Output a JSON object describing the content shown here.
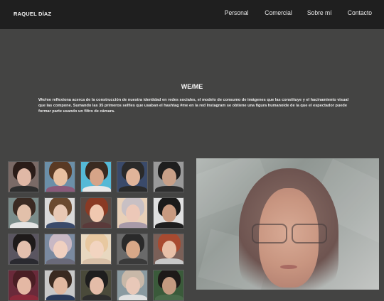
{
  "header": {
    "brand": "RAQUEL DÍAZ",
    "nav": [
      "Personal",
      "Comercial",
      "Sobre mí",
      "Contacto"
    ]
  },
  "section": {
    "title": "WE/ME",
    "description": "We/me reflexiona acerca de la construcción de nuestra identidad en redes sociales, el modelo de consumo de imágenes que las constituye y el hacinamiento visual que las compone. Sumando las 35 primeros selfies que usaban el hashtag #me en la red Instagram se obtiene una figura humanoide de la que el espectador puede formar parte usando un filtro de cámara."
  },
  "gallery": {
    "thumbnails": [
      {
        "bg": "#7a6a66",
        "hair": "#2a1c18",
        "skin": "#e0b8a6",
        "cloth": "#2e2e2e"
      },
      {
        "bg": "#6b8fa8",
        "hair": "#5a3a24",
        "skin": "#e8c0a0",
        "cloth": "#8a5a7a"
      },
      {
        "bg": "#55b9d6",
        "hair": "#3a2a20",
        "skin": "#d6a488",
        "cloth": "#e8e8e8"
      },
      {
        "bg": "#3a4a6a",
        "hair": "#2a2a2a",
        "skin": "#e0b49a",
        "cloth": "#2a2a2a"
      },
      {
        "bg": "#9a9a9a",
        "hair": "#1e1e1e",
        "skin": "#c8a088",
        "cloth": "#2e2e2e"
      },
      {
        "bg": "#7a8c8a",
        "hair": "#3a2a22",
        "skin": "#e2c0aa",
        "cloth": "#e4e4e4"
      },
      {
        "bg": "#d9d9d9",
        "hair": "#6b4a30",
        "skin": "#e8c8b4",
        "cloth": "#3a4a6a"
      },
      {
        "bg": "#5a4a44",
        "hair": "#8a3a24",
        "skin": "#f0c8b0",
        "cloth": "#5a3a3a"
      },
      {
        "bg": "#e8d0b8",
        "hair": "#c8c0c4",
        "skin": "#ecc8b8",
        "cloth": "#a89aa8"
      },
      {
        "bg": "#e0e0e0",
        "hair": "#1a1a1a",
        "skin": "#c89a80",
        "cloth": "#1e1e1e"
      },
      {
        "bg": "#5a5560",
        "hair": "#1e1a1a",
        "skin": "#e4c0ae",
        "cloth": "#2a2a30"
      },
      {
        "bg": "#7a8aa0",
        "hair": "#c8b8c4",
        "skin": "#f0d0c0",
        "cloth": "#6a6a7a"
      },
      {
        "bg": "#e8d8c0",
        "hair": "#e8c8a0",
        "skin": "#f2d4c0",
        "cloth": "#d8c0a8"
      },
      {
        "bg": "#6a6a6a",
        "hair": "#2a2a2a",
        "skin": "#d8a888",
        "cloth": "#3a3a3a"
      },
      {
        "bg": "#7a6058",
        "hair": "#a84a30",
        "skin": "#e8c0a8",
        "cloth": "#c8c8c8"
      },
      {
        "bg": "#6a2a3a",
        "hair": "#4a1e24",
        "skin": "#e4b8a4",
        "cloth": "#8a2a3a"
      },
      {
        "bg": "#c8c8c8",
        "hair": "#3a2a20",
        "skin": "#e0b8a0",
        "cloth": "#2a3a5a"
      },
      {
        "bg": "#4a4a3a",
        "hair": "#1e1e1e",
        "skin": "#e4bca8",
        "cloth": "#2e2e2e"
      },
      {
        "bg": "#8a9aa0",
        "hair": "#c8b8a8",
        "skin": "#e8c8b8",
        "cloth": "#e0e0e0"
      },
      {
        "bg": "#3a5a3a",
        "hair": "#1e1a18",
        "skin": "#c49a80",
        "cloth": "#4a6a4a"
      }
    ],
    "composite_colors": {
      "bg": "#a9aeab",
      "hair": "#6e5450",
      "skin": "#c89580"
    }
  }
}
